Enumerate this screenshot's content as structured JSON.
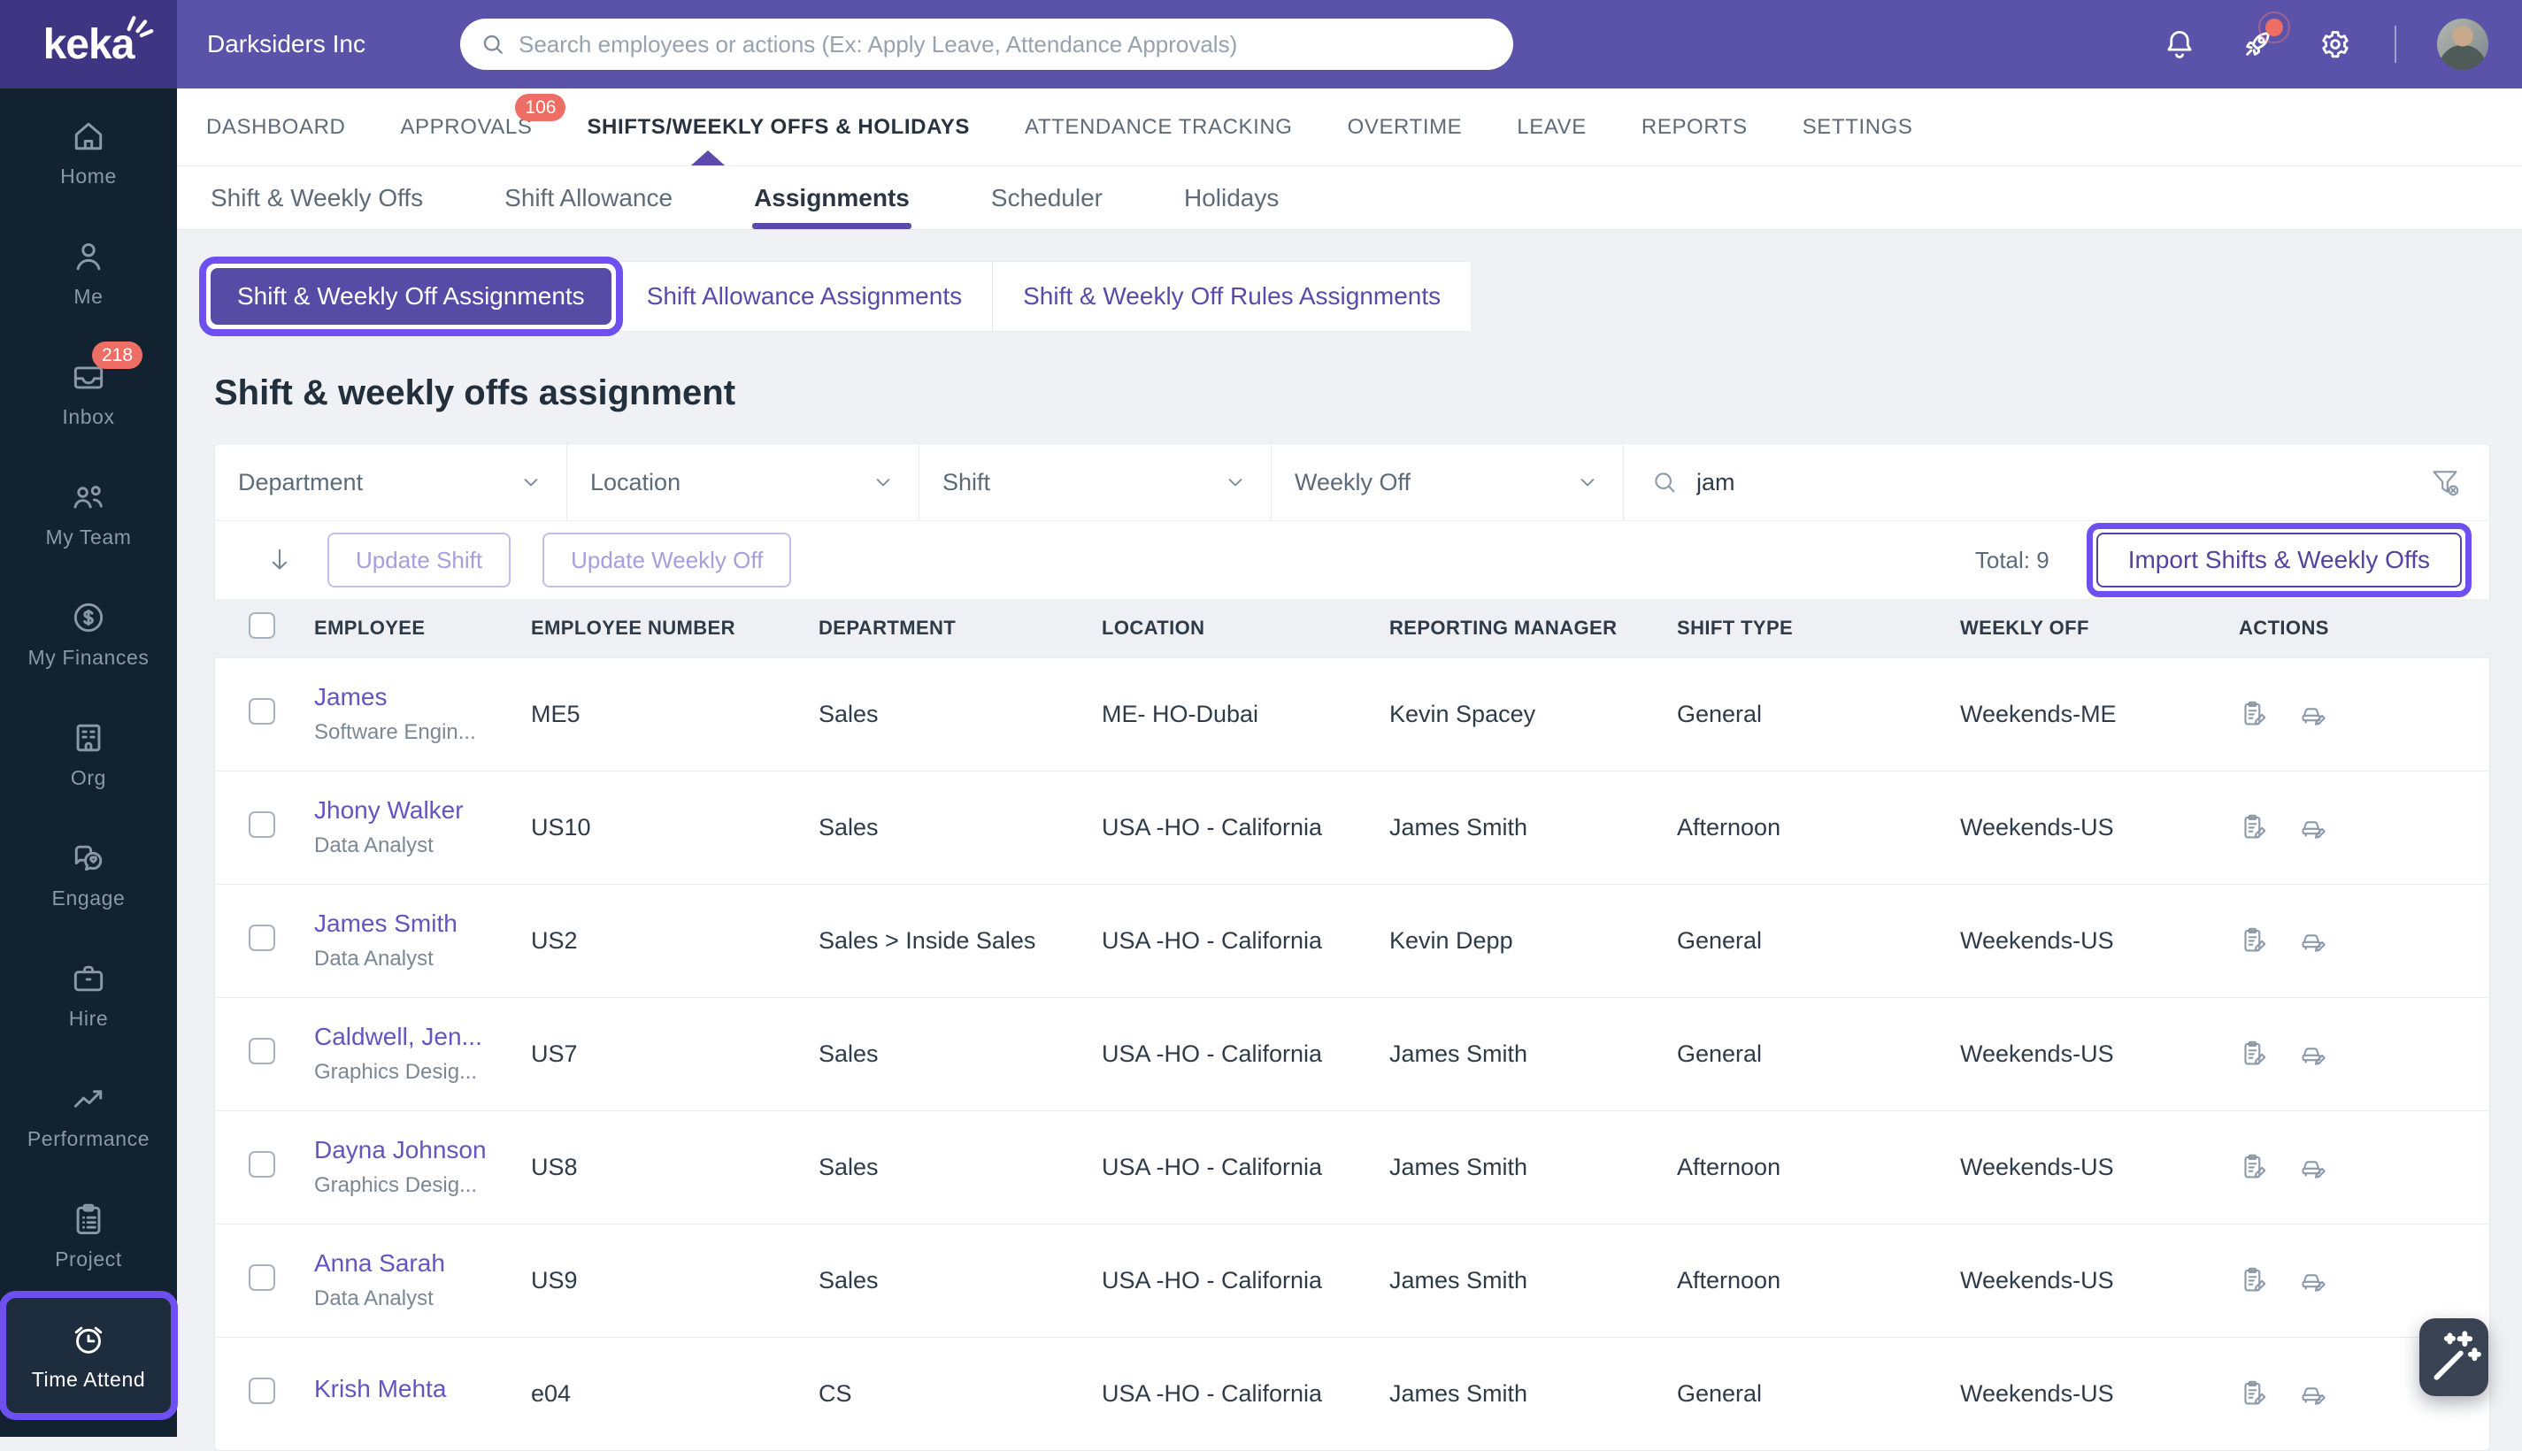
{
  "brand": {
    "logo_text": "keka",
    "company_name": "Darksiders Inc"
  },
  "header": {
    "search_placeholder": "Search employees or actions (Ex: Apply Leave, Attendance Approvals)",
    "icons": [
      "bell",
      "rocket",
      "gear"
    ],
    "rocket_has_notification_dot": true
  },
  "colors": {
    "header_bg": "#5b53a9",
    "logo_bg": "#3e3583",
    "sidebar_bg": "#122230",
    "accent_purple": "#5b4aa9",
    "segment_active_bg": "#564ca6",
    "annotation_highlight": "#6e4ff0",
    "badge_red": "#ee6d64",
    "link_purple": "#6554c0"
  },
  "sidebar": {
    "items": [
      {
        "label": "Home",
        "icon": "home"
      },
      {
        "label": "Me",
        "icon": "user"
      },
      {
        "label": "Inbox",
        "icon": "inbox",
        "badge": "218"
      },
      {
        "label": "My Team",
        "icon": "team"
      },
      {
        "label": "My Finances",
        "icon": "finances"
      },
      {
        "label": "Org",
        "icon": "org"
      },
      {
        "label": "Engage",
        "icon": "engage"
      },
      {
        "label": "Hire",
        "icon": "hire"
      },
      {
        "label": "Performance",
        "icon": "performance"
      },
      {
        "label": "Project",
        "icon": "project"
      },
      {
        "label": "Time Attend",
        "icon": "time-attend",
        "active": true,
        "highlighted": true
      }
    ]
  },
  "nav": {
    "tabs": [
      {
        "label": "DASHBOARD"
      },
      {
        "label": "APPROVALS",
        "badge": "106"
      },
      {
        "label": "SHIFTS/WEEKLY OFFS & HOLIDAYS",
        "active": true
      },
      {
        "label": "ATTENDANCE TRACKING"
      },
      {
        "label": "OVERTIME"
      },
      {
        "label": "LEAVE"
      },
      {
        "label": "REPORTS"
      },
      {
        "label": "SETTINGS"
      }
    ]
  },
  "subnav": {
    "tabs": [
      {
        "label": "Shift & Weekly Offs"
      },
      {
        "label": "Shift Allowance"
      },
      {
        "label": "Assignments",
        "active": true
      },
      {
        "label": "Scheduler"
      },
      {
        "label": "Holidays"
      }
    ]
  },
  "segments": {
    "buttons": [
      {
        "label": "Shift & Weekly Off Assignments",
        "active": true,
        "highlighted": true
      },
      {
        "label": "Shift Allowance Assignments"
      },
      {
        "label": "Shift & Weekly Off Rules Assignments"
      }
    ]
  },
  "page": {
    "title": "Shift & weekly offs assignment"
  },
  "filters": {
    "dropdowns": [
      "Department",
      "Location",
      "Shift",
      "Weekly Off"
    ],
    "search_value": "jam",
    "clear_filter_icon": "funnel-x"
  },
  "toolbar": {
    "update_shift_label": "Update Shift",
    "update_weekly_off_label": "Update Weekly Off",
    "total_label": "Total: 9",
    "import_label": "Import Shifts & Weekly Offs"
  },
  "table": {
    "columns": [
      "EMPLOYEE",
      "EMPLOYEE NUMBER",
      "DEPARTMENT",
      "LOCATION",
      "REPORTING MANAGER",
      "SHIFT TYPE",
      "WEEKLY OFF",
      "ACTIONS"
    ],
    "rows": [
      {
        "name": "James",
        "title": "Software Engin...",
        "number": "ME5",
        "department": "Sales",
        "location": "ME- HO-Dubai",
        "manager": "Kevin Spacey",
        "shift_type": "General",
        "weekly_off": "Weekends-ME"
      },
      {
        "name": "Jhony Walker",
        "title": "Data Analyst",
        "number": "US10",
        "department": "Sales",
        "location": "USA -HO - California",
        "manager": "James Smith",
        "shift_type": "Afternoon",
        "weekly_off": "Weekends-US"
      },
      {
        "name": "James Smith",
        "title": "Data Analyst",
        "number": "US2",
        "department": "Sales > Inside Sales",
        "location": "USA -HO - California",
        "manager": "Kevin Depp",
        "shift_type": "General",
        "weekly_off": "Weekends-US"
      },
      {
        "name": "Caldwell, Jen...",
        "title": "Graphics Desig...",
        "number": "US7",
        "department": "Sales",
        "location": "USA -HO - California",
        "manager": "James Smith",
        "shift_type": "General",
        "weekly_off": "Weekends-US"
      },
      {
        "name": "Dayna Johnson",
        "title": "Graphics Desig...",
        "number": "US8",
        "department": "Sales",
        "location": "USA -HO - California",
        "manager": "James Smith",
        "shift_type": "Afternoon",
        "weekly_off": "Weekends-US"
      },
      {
        "name": "Anna Sarah",
        "title": "Data Analyst",
        "number": "US9",
        "department": "Sales",
        "location": "USA -HO - California",
        "manager": "James Smith",
        "shift_type": "Afternoon",
        "weekly_off": "Weekends-US"
      },
      {
        "name": "Krish Mehta",
        "title": "",
        "number": "e04",
        "department": "CS",
        "location": "USA -HO - California",
        "manager": "James Smith",
        "shift_type": "General",
        "weekly_off": "Weekends-US"
      }
    ]
  }
}
